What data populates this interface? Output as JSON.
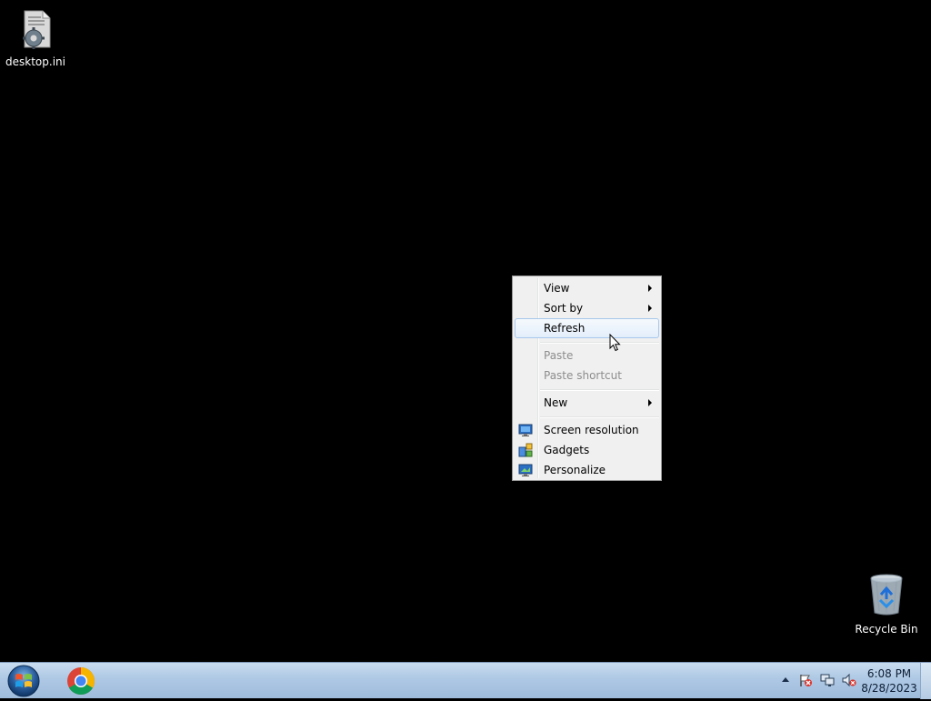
{
  "desktop": {
    "icons": [
      {
        "label": "desktop.ini",
        "icon": "ini-file-icon"
      },
      {
        "label": "Recycle Bin",
        "icon": "recycle-bin-icon"
      }
    ]
  },
  "context_menu": {
    "items": [
      {
        "label": "View",
        "submenu": true
      },
      {
        "label": "Sort by",
        "submenu": true
      },
      {
        "label": "Refresh",
        "state": "hover"
      },
      {
        "label": "Paste",
        "state": "disabled"
      },
      {
        "label": "Paste shortcut",
        "state": "disabled"
      },
      {
        "label": "New",
        "submenu": true
      },
      {
        "label": "Screen resolution",
        "icon": "screen-resolution-icon"
      },
      {
        "label": "Gadgets",
        "icon": "gadgets-icon"
      },
      {
        "label": "Personalize",
        "icon": "personalize-icon"
      }
    ]
  },
  "taskbar": {
    "start": {
      "icon": "windows-start-icon"
    },
    "pinned": [
      {
        "icon": "chrome-icon"
      }
    ],
    "tray": {
      "icons": [
        "show-hidden-icons-arrow",
        "action-center-flag-icon",
        "network-icon",
        "volume-muted-icon"
      ],
      "time": "6:08 PM",
      "date": "8/28/2023"
    }
  },
  "colors": {
    "desktop_bg": "#000000",
    "menu_bg": "#f0f0f0",
    "menu_hover": "#e3eefb",
    "taskbar": "#aec8e4"
  }
}
